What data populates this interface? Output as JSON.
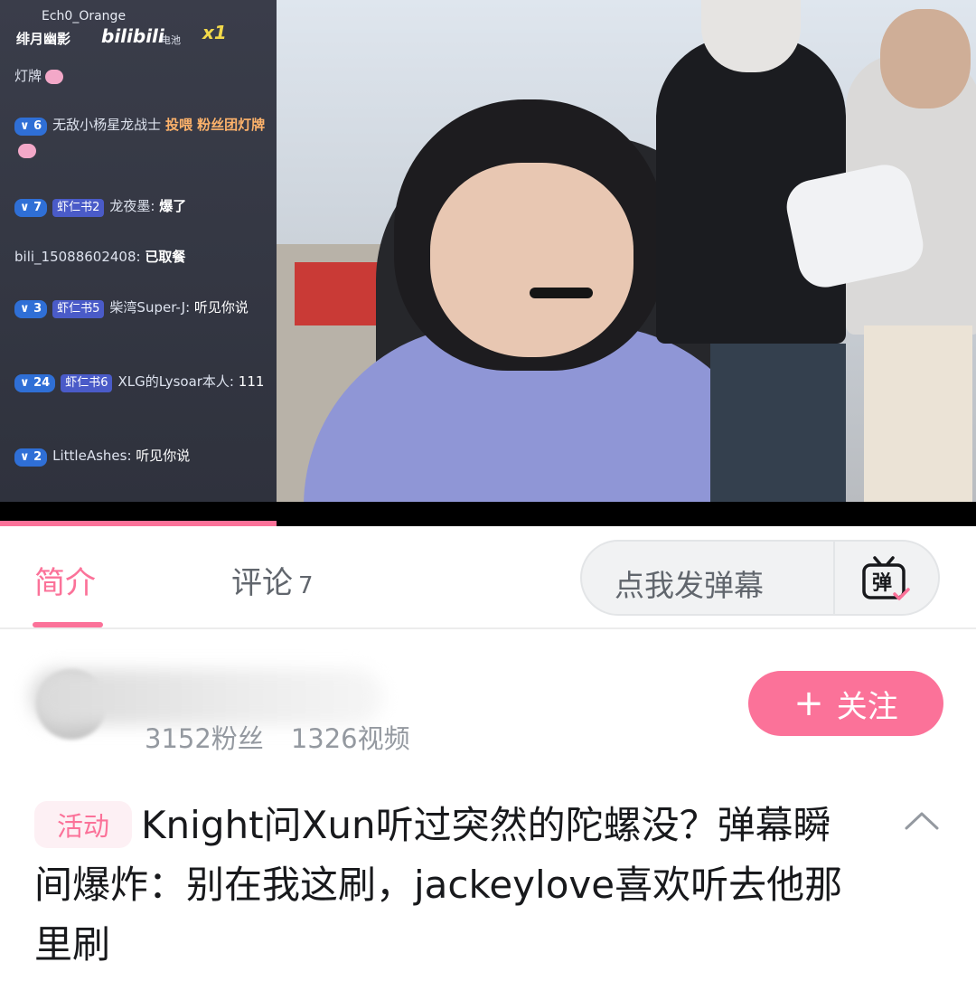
{
  "video": {
    "overlay": {
      "top_user": "Ech0_Orange",
      "streamer": "绯月幽影",
      "logo": "bilibili",
      "logo_sub": "电池",
      "combo": "x1"
    },
    "danmaku": [
      {
        "level": "",
        "medal": "",
        "user": "",
        "text": "灯牌"
      },
      {
        "level": "6",
        "medal": "",
        "user": "无敌小杨星龙战士",
        "text": "投喂 粉丝团灯牌",
        "line2": "丝团灯牌"
      },
      {
        "level": "7",
        "medal": "虾仁书2",
        "user": "龙夜墨:",
        "text": "爆了"
      },
      {
        "level": "",
        "medal": "",
        "user": "bili_15088602408:",
        "text": "已取餐"
      },
      {
        "level": "3",
        "medal": "虾仁书5",
        "user": "柴湾Super-J:",
        "text": "听见你说"
      },
      {
        "level": "24",
        "medal": "虾仁书6",
        "user": "XLG的Lysoar本人:",
        "text": "111"
      },
      {
        "level": "2",
        "medal": "",
        "user": "LittleAshes:",
        "text": "听见你说"
      }
    ],
    "progress_fraction": 0.283
  },
  "tabs": {
    "intro": "简介",
    "comments": "评论",
    "comments_count": "7"
  },
  "danmaku_input": {
    "placeholder": "点我发弹幕",
    "icon_glyph": "弹"
  },
  "uploader": {
    "fans": "3152粉丝",
    "videos": "1326视频",
    "follow_label": "关注",
    "follow_plus": "+"
  },
  "title": {
    "tag": "活动",
    "text": "Knight问Xun听过突然的陀螺没？弹幕瞬间爆炸：别在我这刷，jackeylove喜欢听去他那里刷"
  },
  "colors": {
    "accent": "#fb7299",
    "text_primary": "#18191c",
    "text_secondary": "#61666d",
    "text_muted": "#9499a0"
  }
}
